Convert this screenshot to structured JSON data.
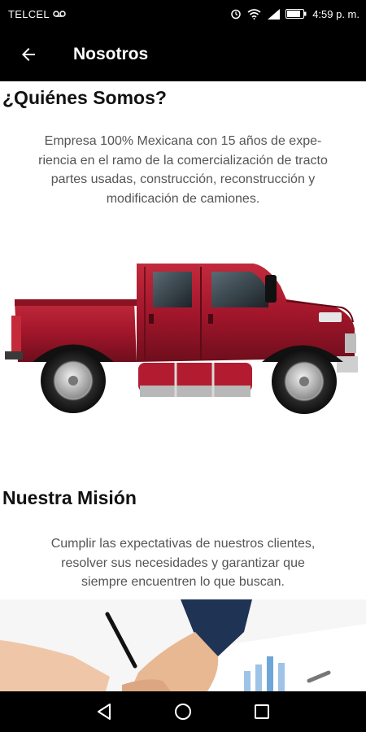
{
  "status_bar": {
    "carrier": "TELCEL",
    "time": "4:59 p. m.",
    "icons": [
      "voicemail-icon",
      "alarm-icon",
      "wifi-icon",
      "signal-icon",
      "battery-icon"
    ]
  },
  "app_bar": {
    "title": "Nosotros",
    "back_icon": "arrow-back-icon"
  },
  "about": {
    "title": "¿Quiénes Somos?",
    "lines": [
      "Empresa 100% Mexicana con 15 años de expe-",
      "riencia en el ramo de la comercialización de tracto",
      "partes usadas, construcción, reconstrucción y",
      "modificación de camiones."
    ]
  },
  "mission": {
    "title": "Nuestra Misión",
    "lines": [
      "Cumplir las expectativas de nuestros clientes,",
      "resolver sus necesidades y garantizar que",
      "siempre encuentren lo que buscan."
    ]
  },
  "nav_bar": {
    "icons": [
      "back-triangle-icon",
      "home-circle-icon",
      "recents-square-icon"
    ]
  },
  "colors": {
    "bar_background": "#000000",
    "truck_red": "#a3162b",
    "body_text": "#555555"
  }
}
